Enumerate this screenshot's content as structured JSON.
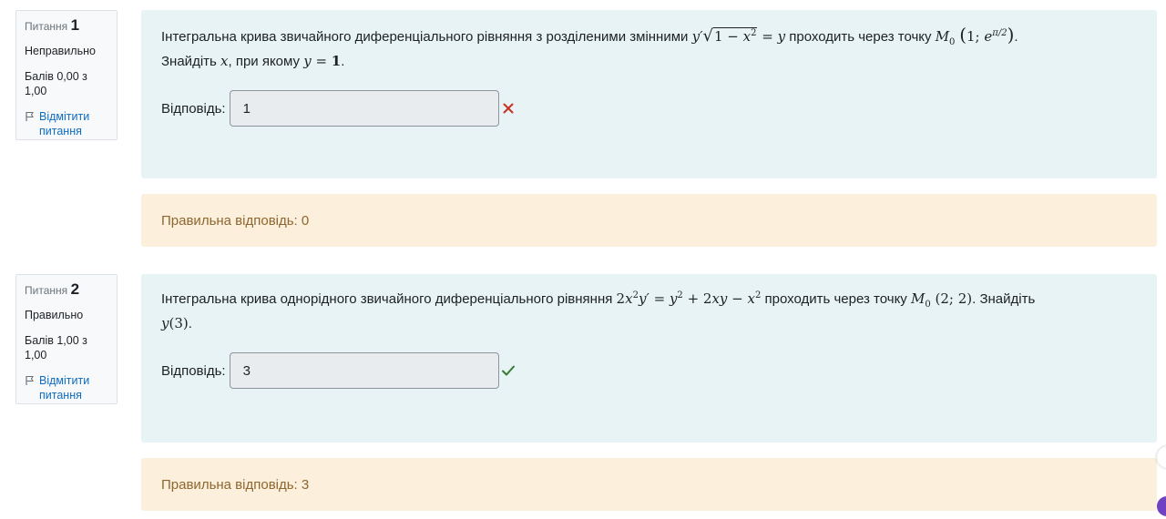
{
  "questions": [
    {
      "label": "Питання",
      "number": "1",
      "state": "Неправильно",
      "grade": "Балів 0,00 з 1,00",
      "flag_label": "Відмітити питання",
      "text_before": "Інтегральна крива звичайного диференціального рівняння з розділеними змінними ",
      "text_middle": " проходить через точку ",
      "text_find": "Знайдіть ",
      "text_find2": ", при якому ",
      "answer_label": "Відповідь:",
      "answer_value": "1",
      "result_icon": "cross-icon",
      "correct_answer": "Правильна відповідь: 0"
    },
    {
      "label": "Питання",
      "number": "2",
      "state": "Правильно",
      "grade": "Балів 1,00 з 1,00",
      "flag_label": "Відмітити питання",
      "text_before": "Інтегральна крива однорідного звичайного диференціального рівняння ",
      "text_middle": " проходить через точку ",
      "text_find": ". Знайдіть",
      "answer_label": "Відповідь:",
      "answer_value": "3",
      "result_icon": "check-icon",
      "correct_answer": "Правильна відповідь: 3"
    }
  ],
  "colors": {
    "formulation_bg": "#e7f3f5",
    "outcome_bg": "#fcefdc",
    "outcome_text": "#8e662e",
    "link": "#0f6cbf",
    "incorrect": "#ca3120",
    "correct": "#357a32"
  }
}
